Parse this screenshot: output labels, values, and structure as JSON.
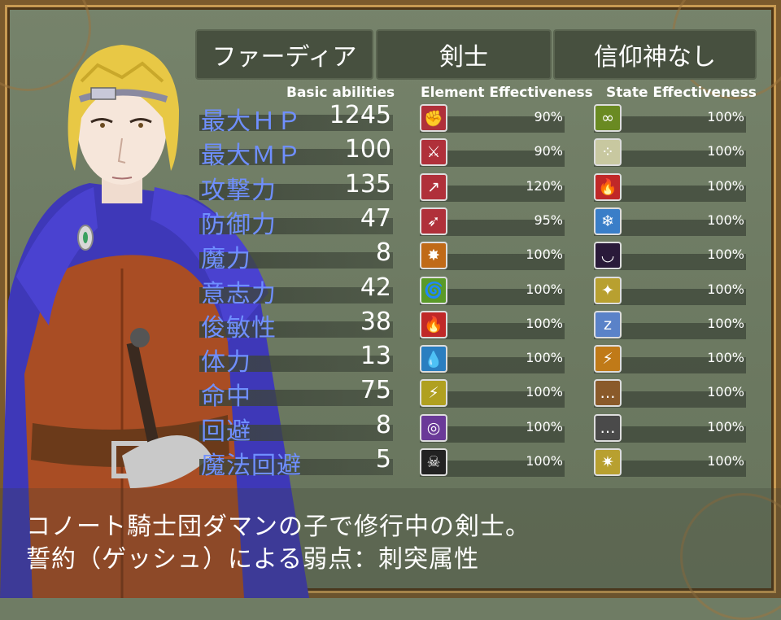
{
  "header": {
    "name": "ファーディア",
    "class": "剣士",
    "faith": "信仰神なし"
  },
  "columns": {
    "basic": "Basic abilities",
    "element": "Element Effectiveness",
    "state": "State Effectiveness"
  },
  "stats": [
    {
      "label": "最大ＨＰ",
      "value": "1245"
    },
    {
      "label": "最大ＭＰ",
      "value": "100"
    },
    {
      "label": "攻撃力",
      "value": "135"
    },
    {
      "label": "防御力",
      "value": "47"
    },
    {
      "label": "魔力",
      "value": "8"
    },
    {
      "label": "意志力",
      "value": "42"
    },
    {
      "label": "俊敏性",
      "value": "38"
    },
    {
      "label": "体力",
      "value": "13"
    },
    {
      "label": "命中",
      "value": "75"
    },
    {
      "label": "回避",
      "value": "8"
    },
    {
      "label": "魔法回避",
      "value": "5"
    }
  ],
  "elements": [
    {
      "icon": "fist-icon",
      "glyph": "✊",
      "color": "#b0303a",
      "value": "90%"
    },
    {
      "icon": "slash-icon",
      "glyph": "⚔",
      "color": "#b0303a",
      "value": "90%"
    },
    {
      "icon": "pierce-icon",
      "glyph": "↗",
      "color": "#b0303a",
      "value": "120%"
    },
    {
      "icon": "bow-icon",
      "glyph": "➶",
      "color": "#b0303a",
      "value": "95%"
    },
    {
      "icon": "impact-icon",
      "glyph": "✸",
      "color": "#c06a18",
      "value": "100%"
    },
    {
      "icon": "wind-icon",
      "glyph": "🌀",
      "color": "#5a9a28",
      "value": "100%"
    },
    {
      "icon": "fire-icon",
      "glyph": "🔥",
      "color": "#c02828",
      "value": "100%"
    },
    {
      "icon": "water-icon",
      "glyph": "💧",
      "color": "#2a7ec0",
      "value": "100%"
    },
    {
      "icon": "thunder-icon",
      "glyph": "⚡",
      "color": "#b0a020",
      "value": "100%"
    },
    {
      "icon": "vortex-icon",
      "glyph": "◎",
      "color": "#6a3a98",
      "value": "100%"
    },
    {
      "icon": "skull-icon",
      "glyph": "☠",
      "color": "#222222",
      "value": "100%"
    }
  ],
  "states": [
    {
      "icon": "poison-bubbles-icon",
      "glyph": "∞",
      "color": "#6a8a22",
      "value": "100%"
    },
    {
      "icon": "dots-icon",
      "glyph": "⁘",
      "color": "#c8c8a0",
      "value": "100%"
    },
    {
      "icon": "burn-icon",
      "glyph": "🔥",
      "color": "#c02828",
      "value": "100%"
    },
    {
      "icon": "freeze-icon",
      "glyph": "❄",
      "color": "#3a7ec8",
      "value": "100%"
    },
    {
      "icon": "closed-eye-icon",
      "glyph": "◡",
      "color": "#2a1a3a",
      "value": "100%"
    },
    {
      "icon": "stars-icon",
      "glyph": "✦",
      "color": "#b8a030",
      "value": "100%"
    },
    {
      "icon": "sleep-icon",
      "glyph": "z",
      "color": "#5a82c8",
      "value": "100%"
    },
    {
      "icon": "shock-icon",
      "glyph": "⚡",
      "color": "#c07a18",
      "value": "100%"
    },
    {
      "icon": "speech-bubble-icon",
      "glyph": "…",
      "color": "#8a5a2a",
      "value": "100%"
    },
    {
      "icon": "silence-bubble-icon",
      "glyph": "…",
      "color": "#4a4a4a",
      "value": "100%"
    },
    {
      "icon": "confusion-icon",
      "glyph": "✷",
      "color": "#b8a030",
      "value": "100%"
    }
  ],
  "description": {
    "line1": "コノート騎士団ダマンの子で修行中の剣士。",
    "line2": "誓約（ゲッシュ）による弱点：刺突属性"
  }
}
